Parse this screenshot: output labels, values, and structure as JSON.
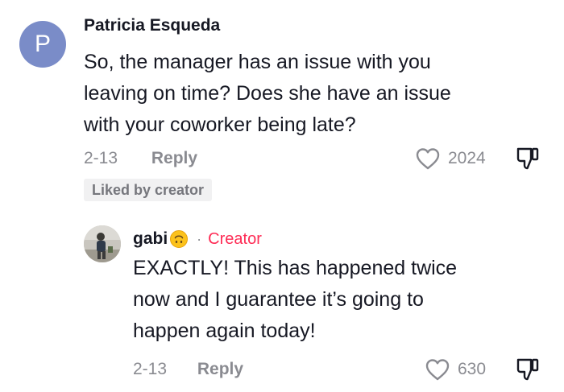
{
  "comment": {
    "avatar_letter": "P",
    "author": "Patricia Esqueda",
    "text_lines": [
      "So, the manager has an issue with you",
      "leaving on time? Does she have an issue",
      "with your coworker being late?"
    ],
    "date": "2-13",
    "reply_label": "Reply",
    "like_count": "2024",
    "badge": "Liked by creator"
  },
  "reply": {
    "author": "gabi",
    "separator": "·",
    "creator_label": "Creator",
    "text_lines": [
      "EXACTLY! This has happened twice",
      "now and I guarantee it’s going to",
      "happen again today!"
    ],
    "date": "2-13",
    "reply_label": "Reply",
    "like_count": "630"
  },
  "icons": {
    "heart": "heart-outline-icon",
    "dislike": "thumbs-down-outline-icon",
    "emoji": "upside-down-face-emoji"
  },
  "colors": {
    "avatar_bg": "#7a8cc8",
    "creator": "#fe2c55",
    "muted": "#8a8b91",
    "text": "#161823",
    "badge_bg": "#f1f1f2"
  }
}
